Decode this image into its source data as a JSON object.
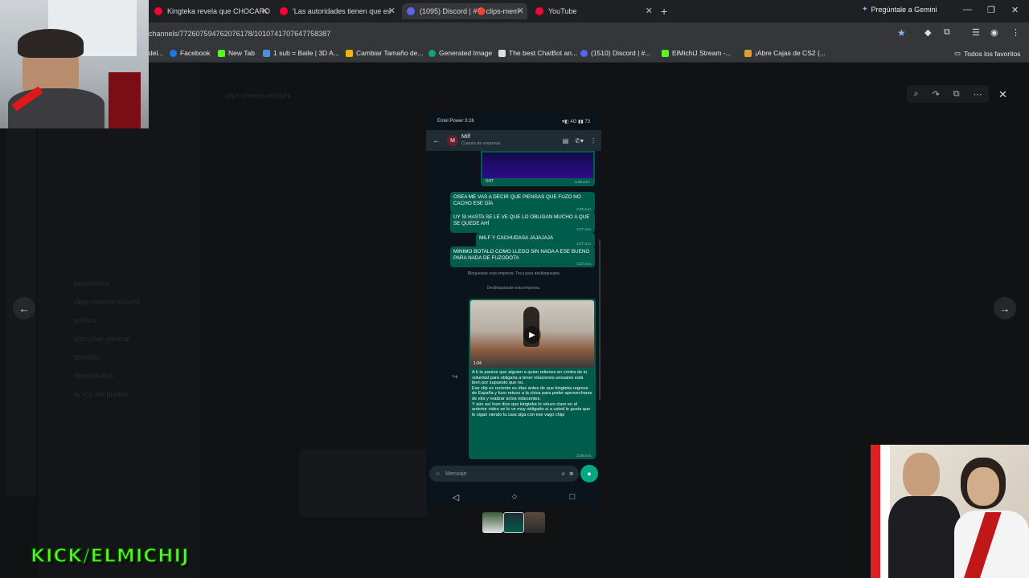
{
  "browser": {
    "tabs": [
      {
        "title": "Kingteka revela que CHOCARO",
        "icon_color": "#ff0033",
        "icon": "youtube-icon"
      },
      {
        "title": "'Las autoridades tienen que es",
        "icon_color": "#ff0033",
        "icon": "youtube-icon"
      },
      {
        "title": "(1095) Discord | #🔴clips-mem",
        "icon_color": "#5865f2",
        "icon": "discord-icon"
      },
      {
        "title": "YouTube",
        "icon_color": "#ff0033",
        "icon": "youtube-icon"
      }
    ],
    "gemini_label": "Pregúntale a Gemini",
    "url": "channels/772607594762076178/1010741707647758387",
    "bookmarks": [
      {
        "label": "del...",
        "color": "#888888"
      },
      {
        "label": "Facebook",
        "color": "#1877f2"
      },
      {
        "label": "New Tab",
        "color": "#53fc18"
      },
      {
        "label": "1 sub = Baile | 3D A...",
        "color": "#4a90e2"
      },
      {
        "label": "Cambiar Tamaño de...",
        "color": "#f4b400"
      },
      {
        "label": "Generated Image",
        "color": "#10a37f"
      },
      {
        "label": "The best ChatBot an...",
        "color": "#dddddd"
      },
      {
        "label": "(1510) Discord | #...",
        "color": "#5865f2"
      },
      {
        "label": "ElMichiJ Stream -...",
        "color": "#53fc18"
      },
      {
        "label": "¡Abre Cajas de CS2 (...",
        "color": "#e0a030"
      }
    ],
    "all_bookmarks": "Todos los favoritos"
  },
  "background": {
    "channel_title": "clips-memes-elmichi",
    "sidebar_items": [
      "banneados",
      "clips-memes-elmichi",
      "política",
      "solo-chat-general",
      "pruebas",
      "directos-kick",
      "la voz del pueblo"
    ]
  },
  "phone": {
    "status_left": "Entel Power 3:26",
    "status_right": "▾◧ 4G ▮▮ 73",
    "contact_initial": "M",
    "contact_name": "Milf",
    "contact_sub": "Cuenta de empresa",
    "video_duration_1": "0:07",
    "video_time_1": "2:26 a.m.",
    "messages": [
      {
        "text": "OSEA ME VAS A DECIR QUE PIENSAS QUE FUZO NO CACHO ESE DÍA",
        "time": "2:26 a.m."
      },
      {
        "text": "UY SI HASTA SE LE VE QUE LO OBLIGAN MUCHO A QUE SE QUEDE AHÍ",
        "time": "2:27 a.m."
      },
      {
        "text": "MILF Y CACHUDASA JAJAJAJA",
        "time": "2:27 a.m."
      },
      {
        "text": "MINIMO BOTALO COMO LLEGO SIN NADA A ESE BUENO PARA NADA DE FUZODOTA",
        "time": "2:27 a.m."
      }
    ],
    "system_1": "Bloqueaste esta empresa. Toca para desbloquearla",
    "system_2": "Desbloqueaste esta empresa.",
    "video_duration_2": "1:04",
    "long_message": "A ti te parece que alguien a quien retienes en contra de tu voluntad para obligarla a tener relaciones sexuales está bien por supuesto que no.\nEse clip es reciente es días antes de que kingteka regrese de España y fuzo retuvo a la chica para poder aprovecharse de ella y realizar actos indecentes.\nY aún así fuzo dice que kingteka lo retuvo claro en el anterior video se le ve muy obligado si a usted le gusta que le sigan viendo la cara siga con ese vago chipi",
    "long_time": "3:26 a.m.",
    "input_placeholder": "Mensaje"
  },
  "overlay": {
    "channel_tag": "KICK/ELMICHIJ"
  },
  "colors": {
    "whatsapp_bubble": "#005c4b",
    "whatsapp_accent": "#00a884",
    "kick_green": "#53fc18"
  }
}
